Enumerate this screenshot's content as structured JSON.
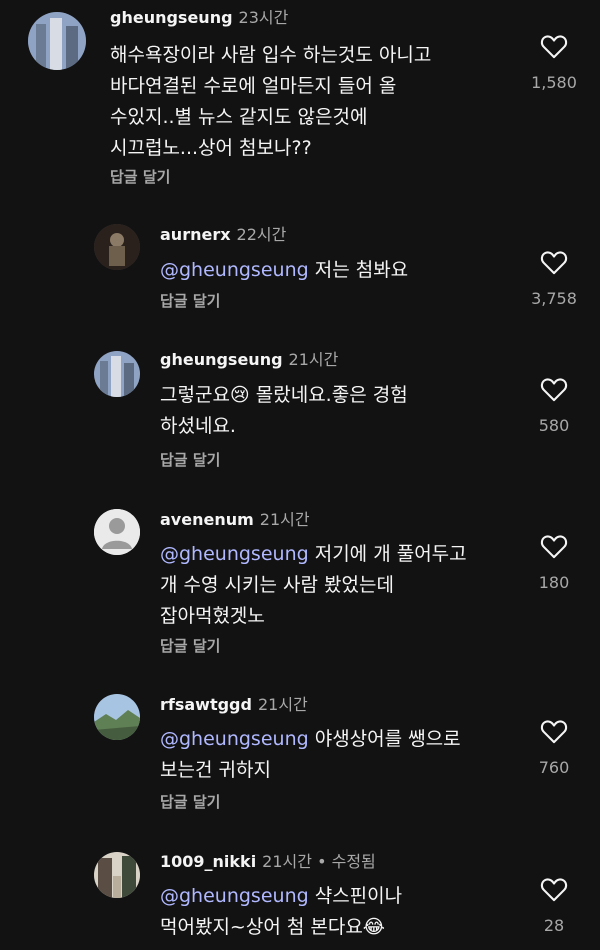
{
  "comments": [
    {
      "username": "gheungseung",
      "time": "23시간",
      "lines": [
        "해수욕장이라 사람 입수 하는것도 아니고",
        "바다연결된 수로에 얼마든지 들어 올",
        "수있지..별 뉴스 같지도 않은것에",
        "시끄럽노...상어 첨보나??"
      ],
      "reply_label": "답글 달기",
      "likes": "1,580"
    },
    {
      "username": "aurnerx",
      "time": "22시간",
      "mention": "@gheungseung",
      "lines": [
        " 저는 첨봐요"
      ],
      "reply_label": "답글 달기",
      "likes": "3,758"
    },
    {
      "username": "gheungseung",
      "time": "21시간",
      "lines": [
        "그렇군요😢 몰랐네요.좋은 경험",
        "하셨네요."
      ],
      "reply_label": "답글 달기",
      "likes": "580"
    },
    {
      "username": "avenenum",
      "time": "21시간",
      "mention": "@gheungseung",
      "lines": [
        " 저기에 개 풀어두고",
        "개 수영 시키는 사람 봤었는데",
        "잡아먹혔겟노"
      ],
      "reply_label": "답글 달기",
      "likes": "180"
    },
    {
      "username": "rfsawtggd",
      "time": "21시간",
      "mention": "@gheungseung",
      "lines": [
        " 야생상어를 쌩으로",
        "보는건 귀하지"
      ],
      "reply_label": "답글 달기",
      "likes": "760"
    },
    {
      "username": "1009_nikki",
      "time": "21시간",
      "edited": " • 수정됨",
      "mention": "@gheungseung",
      "lines": [
        " 샥스핀이나",
        "먹어봤지~상어 첨 본다요😂"
      ],
      "likes": "28"
    }
  ],
  "icons": {
    "like": "heart-outline-icon"
  },
  "colors": {
    "background": "#121212",
    "mention": "#b0b8ff",
    "secondary": "#a8a8a8"
  }
}
